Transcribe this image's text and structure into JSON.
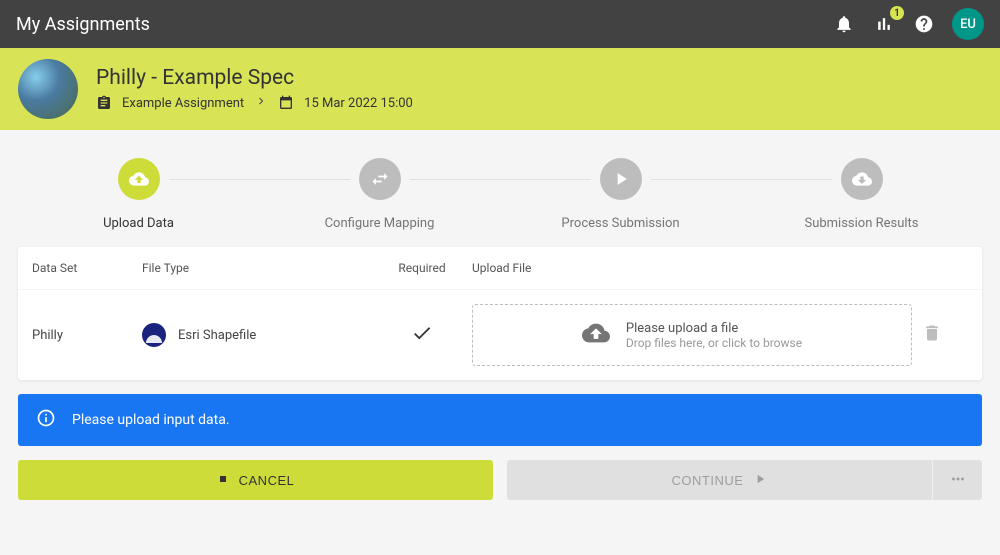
{
  "topbar": {
    "title": "My Assignments",
    "badge_count": "1",
    "avatar_initials": "EU"
  },
  "banner": {
    "title": "Philly - Example Spec",
    "assignment_label": "Example Assignment",
    "date_label": "15 Mar 2022 15:00"
  },
  "stepper": [
    {
      "label": "Upload Data"
    },
    {
      "label": "Configure Mapping"
    },
    {
      "label": "Process Submission"
    },
    {
      "label": "Submission Results"
    }
  ],
  "table": {
    "headers": {
      "data_set": "Data Set",
      "file_type": "File Type",
      "required": "Required",
      "upload_file": "Upload File"
    },
    "row": {
      "data_set": "Philly",
      "file_type": "Esri Shapefile"
    }
  },
  "dropzone": {
    "title": "Please upload a file",
    "subtitle": "Drop files here, or click to browse"
  },
  "alert": {
    "message": "Please upload input data."
  },
  "actions": {
    "cancel": "CANCEL",
    "continue": "CONTINUE"
  },
  "colors": {
    "accent": "#cddc39",
    "info": "#1976f2"
  }
}
